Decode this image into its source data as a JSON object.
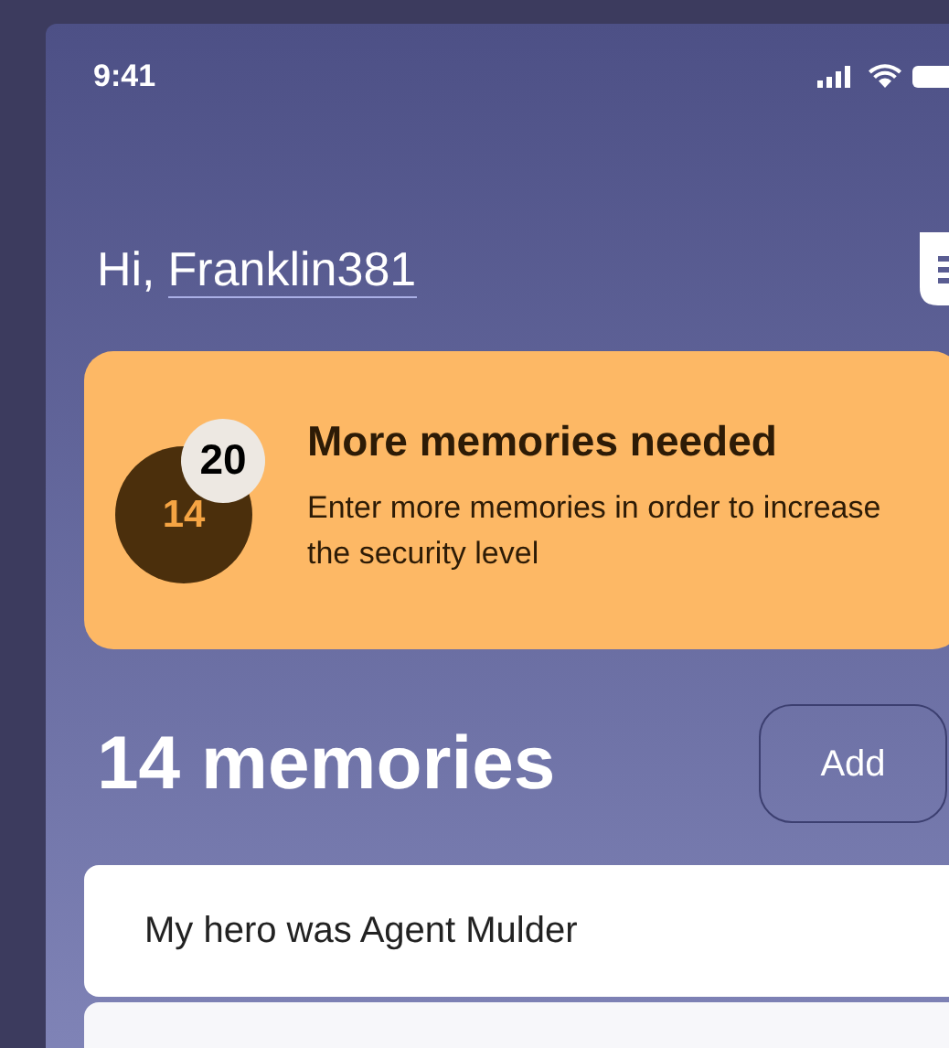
{
  "status_bar": {
    "time": "9:41"
  },
  "greeting": {
    "prefix": "Hi,",
    "username": "Franklin381"
  },
  "alert": {
    "goal": "20",
    "count": "14",
    "title": "More memories needed",
    "message": "Enter more memories in order to increase the security level"
  },
  "memories": {
    "heading": "14 memories",
    "add_button": "Add",
    "items": [
      {
        "text": "My hero was Agent Mulder"
      }
    ]
  }
}
